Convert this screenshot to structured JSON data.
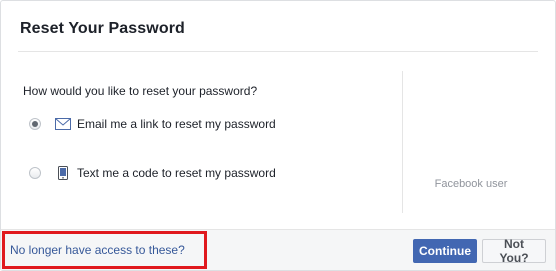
{
  "dialog": {
    "title": "Reset Your Password"
  },
  "reset_options": {
    "question": "How would you like to reset your password?",
    "options": [
      {
        "label": "Email me a link to reset my password",
        "icon": "envelope-icon",
        "selected": true
      },
      {
        "label": "Text me a code to reset my password",
        "icon": "phone-icon",
        "selected": false
      }
    ]
  },
  "account": {
    "name": "Facebook user"
  },
  "footer": {
    "no_access_link": "No longer have access to these?",
    "continue_label": "Continue",
    "not_you_label": "Not You?"
  },
  "colors": {
    "primary_button": "#4267b2",
    "link": "#365899",
    "highlight": "#e0191e"
  }
}
